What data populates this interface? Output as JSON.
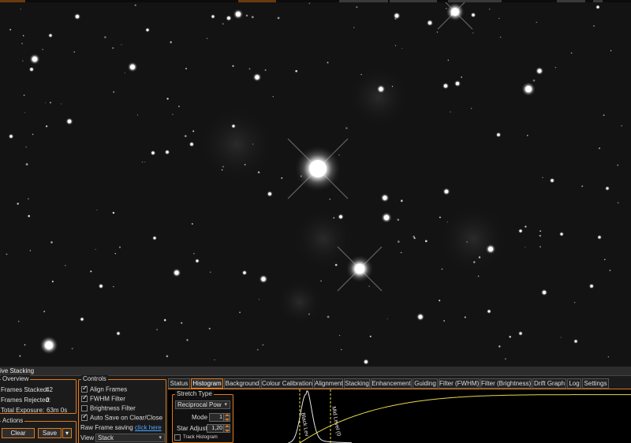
{
  "panel": {
    "title": "ive Stacking"
  },
  "overview": {
    "title": "Overview",
    "frames_stacked_label": "Frames Stacked:",
    "frames_stacked_value": "42",
    "frames_rejected_label": "Frames Rejected:",
    "frames_rejected_value": "0",
    "total_exposure_label": "Total Exposure:",
    "total_exposure_value": "63m 0s"
  },
  "actions": {
    "title": "Actions",
    "clear_label": "Clear",
    "save_label": "Save"
  },
  "controls": {
    "title": "Controls",
    "items": [
      {
        "label": "Align Frames",
        "checked": true
      },
      {
        "label": "FWHM Filter",
        "checked": true
      },
      {
        "label": "Brightness Filter",
        "checked": false
      },
      {
        "label": "Auto Save on Clear/Close",
        "checked": true
      }
    ],
    "raw_frame_label": "Raw Frame saving",
    "raw_frame_link": "click here",
    "view_label": "View",
    "view_value": "Stack"
  },
  "tabs": [
    {
      "label": "Status",
      "active": false
    },
    {
      "label": "Histogram",
      "active": true
    },
    {
      "label": "Background",
      "active": false
    },
    {
      "label": "Colour Calibration",
      "active": false
    },
    {
      "label": "Alignment",
      "active": false
    },
    {
      "label": "Stacking",
      "active": false
    },
    {
      "label": "Enhancement",
      "active": false
    },
    {
      "label": "Guiding",
      "active": false
    },
    {
      "label": "Filter (FWHM)",
      "active": false
    },
    {
      "label": "Filter (Brightness)",
      "active": false
    },
    {
      "label": "Drift Graph",
      "active": false
    },
    {
      "label": "Log",
      "active": false
    },
    {
      "label": "Settings",
      "active": false
    }
  ],
  "stretch": {
    "title": "Stretch Type",
    "type_value": "Reciprocal Pow",
    "mode_label": "Mode",
    "mode_value": "1",
    "star_adjust_label": "Star Adjust",
    "star_adjust_value": "1,20",
    "track_histogram_label": "Track Histogram"
  },
  "histogram": {
    "black_level_label": "Black Lev",
    "mid_level_label": "Mid Level (0",
    "curve_color": "#e8d84a",
    "accent_color": "#e07a1a"
  }
}
